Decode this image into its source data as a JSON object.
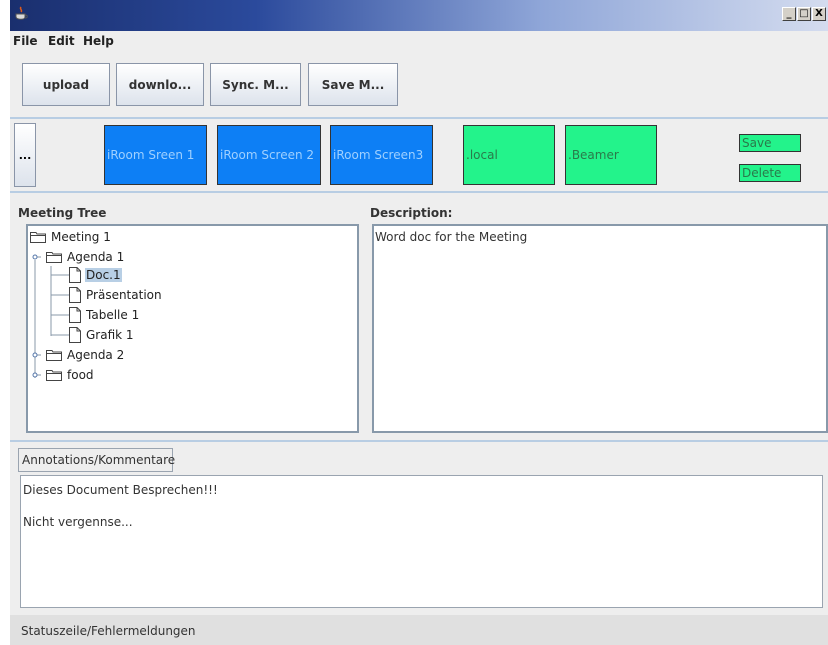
{
  "menu": {
    "file": "File",
    "edit": "Edit",
    "help": "Help"
  },
  "window_buttons": {
    "minimize": "_",
    "maximize": "□",
    "close": "X"
  },
  "toolbar": {
    "upload": "upload",
    "download": "downlo...",
    "sync": "Sync. M...",
    "save": "Save M..."
  },
  "screens": {
    "more": "...",
    "tiles": [
      {
        "label": "iRoom Sreen 1",
        "color": "#0d7ff5"
      },
      {
        "label": "iRoom Screen 2",
        "color": "#0d7ff5"
      },
      {
        "label": "iRoom Screen3",
        "color": "#0d7ff5"
      },
      {
        "label": ".local",
        "color": "#23f38b"
      },
      {
        "label": ".Beamer",
        "color": "#23f38b"
      }
    ],
    "save": "Save",
    "delete": "Delete"
  },
  "meeting_tree": {
    "title": "Meeting Tree",
    "nodes": [
      {
        "label": "Meeting 1",
        "type": "folder"
      },
      {
        "label": "Agenda 1",
        "type": "folder",
        "expanded": true
      },
      {
        "label": "Doc.1",
        "type": "document",
        "selected": true
      },
      {
        "label": "Präsentation",
        "type": "document"
      },
      {
        "label": "Tabelle 1",
        "type": "document"
      },
      {
        "label": "Grafik 1",
        "type": "document"
      },
      {
        "label": "Agenda 2",
        "type": "folder",
        "expanded": false
      },
      {
        "label": "food",
        "type": "folder",
        "expanded": false
      }
    ]
  },
  "description": {
    "title": "Description:",
    "text": "Word doc for the Meeting"
  },
  "annotations": {
    "tab": "Annotations/Kommentare",
    "lines": [
      "Dieses Document Besprechen!!!",
      "",
      "Nicht vergennse..."
    ]
  },
  "status": "Statuszeile/Fehlermeldungen",
  "colors": {
    "accent_blue": "#0d7ff5",
    "accent_green": "#23f38b",
    "border": "#8899aa"
  }
}
